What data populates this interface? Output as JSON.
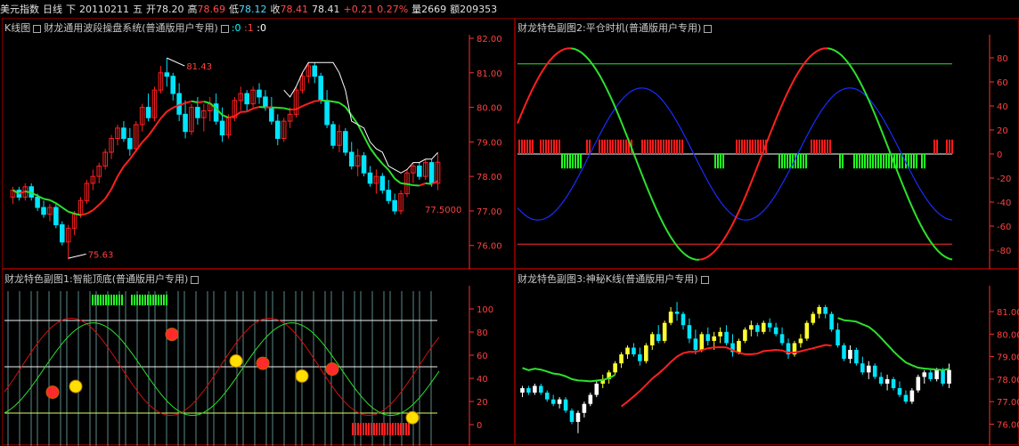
{
  "header": {
    "symbol": "美元指数",
    "period": "日线",
    "period_dir": "下",
    "date": "20110211",
    "weekday": "五",
    "open_label": "开",
    "open": "78.20",
    "high_label": "高",
    "high": "78.69",
    "low_label": "低",
    "low": "78.12",
    "close_label": "收",
    "close": "78.41",
    "last": "78.41",
    "change": "+0.21",
    "change_pct": "0.27%",
    "volume_label": "量",
    "volume": "2669",
    "amount_label": "额",
    "amount": "209353"
  },
  "main_panel": {
    "title_prefix": "K线图",
    "title": "财龙通用波段操盘系统(普通版用户专用)",
    "flags": [
      {
        "text": ":0",
        "color": "#00ffff"
      },
      {
        "text": ":1",
        "color": "#ff4040"
      },
      {
        "text": ":0",
        "color": "#ffffff"
      }
    ],
    "y_ticks": [
      "82.00",
      "81.00",
      "80.00",
      "79.00",
      "78.00",
      "77.00",
      "76.00"
    ],
    "annotations": {
      "high": "81.43",
      "low": "75.63",
      "last": "77.5000"
    }
  },
  "sub1": {
    "title": "财龙特色副图1:智能顶底(普通版用户专用)",
    "y_ticks": [
      "100",
      "80",
      "60",
      "40",
      "20",
      "0"
    ]
  },
  "sub2": {
    "title": "财龙特色副图2:平仓时机(普通版用户专用)",
    "y_ticks": [
      "80",
      "60",
      "40",
      "20",
      "0",
      "-20",
      "-40",
      "-60",
      "-80"
    ]
  },
  "sub3": {
    "title": "财龙特色副图3:神秘K线(普通版用户专用)",
    "y_ticks": [
      "81.00",
      "80.00",
      "79.00",
      "78.00",
      "77.00",
      "76.00"
    ]
  },
  "colors": {
    "up": "#ff2020",
    "down": "#00e5ff",
    "ma_red": "#ff2020",
    "ma_green": "#2de02d",
    "blue": "#1a2cff",
    "yellow": "#ffff30",
    "axis": "#ff3030",
    "frame": "#7a0000"
  },
  "chart_data": {
    "type": "candlestick",
    "series": [
      {
        "values": [
          [
            77.4,
            77.7,
            77.2,
            77.6
          ],
          [
            77.6,
            77.7,
            77.3,
            77.4
          ],
          [
            77.4,
            77.8,
            77.3,
            77.7
          ],
          [
            77.7,
            77.8,
            77.3,
            77.4
          ],
          [
            77.4,
            77.5,
            77.0,
            77.1
          ],
          [
            77.1,
            77.3,
            76.8,
            76.9
          ],
          [
            76.9,
            77.2,
            76.7,
            77.1
          ],
          [
            77.1,
            77.2,
            76.5,
            76.6
          ],
          [
            76.6,
            76.7,
            76.0,
            76.1
          ],
          [
            76.1,
            76.6,
            75.6,
            76.5
          ],
          [
            76.5,
            77.0,
            76.3,
            76.9
          ],
          [
            76.9,
            77.4,
            76.8,
            77.3
          ],
          [
            77.3,
            77.9,
            77.2,
            77.8
          ],
          [
            77.8,
            78.2,
            77.6,
            78.0
          ],
          [
            78.0,
            78.4,
            77.8,
            78.3
          ],
          [
            78.3,
            78.8,
            78.2,
            78.7
          ],
          [
            78.7,
            79.2,
            78.5,
            79.1
          ],
          [
            79.1,
            79.5,
            78.9,
            79.4
          ],
          [
            79.4,
            79.6,
            79.0,
            79.1
          ],
          [
            79.1,
            79.4,
            78.6,
            78.8
          ],
          [
            78.8,
            79.6,
            78.7,
            79.5
          ],
          [
            79.5,
            80.1,
            79.3,
            80.0
          ],
          [
            80.0,
            80.4,
            79.6,
            79.7
          ],
          [
            79.7,
            80.6,
            79.6,
            80.5
          ],
          [
            80.5,
            81.2,
            80.4,
            81.0
          ],
          [
            81.0,
            81.43,
            80.6,
            80.9
          ],
          [
            80.9,
            81.0,
            80.2,
            80.4
          ],
          [
            80.4,
            80.7,
            79.6,
            79.8
          ],
          [
            79.8,
            80.2,
            79.1,
            79.3
          ],
          [
            79.3,
            80.1,
            79.2,
            80.0
          ],
          [
            80.0,
            80.3,
            79.5,
            79.7
          ],
          [
            79.7,
            80.1,
            79.3,
            79.9
          ],
          [
            79.9,
            80.3,
            79.6,
            80.1
          ],
          [
            80.1,
            80.4,
            79.5,
            79.6
          ],
          [
            79.6,
            80.0,
            79.0,
            79.2
          ],
          [
            79.2,
            79.8,
            79.1,
            79.7
          ],
          [
            79.7,
            80.3,
            79.6,
            80.2
          ],
          [
            80.2,
            80.6,
            79.9,
            80.4
          ],
          [
            80.4,
            80.5,
            79.9,
            80.1
          ],
          [
            80.1,
            80.6,
            80.0,
            80.5
          ],
          [
            80.5,
            80.7,
            80.1,
            80.3
          ],
          [
            80.3,
            80.5,
            79.9,
            80.0
          ],
          [
            80.0,
            80.3,
            79.5,
            79.6
          ],
          [
            79.6,
            79.8,
            78.9,
            79.1
          ],
          [
            79.1,
            79.7,
            79.0,
            79.6
          ],
          [
            79.6,
            80.0,
            79.4,
            79.8
          ],
          [
            79.8,
            80.6,
            79.7,
            80.5
          ],
          [
            80.5,
            81.0,
            80.4,
            80.9
          ],
          [
            80.9,
            81.3,
            80.7,
            81.2
          ],
          [
            81.2,
            81.3,
            80.7,
            80.9
          ],
          [
            80.9,
            81.0,
            80.1,
            80.2
          ],
          [
            80.2,
            80.5,
            79.4,
            79.5
          ],
          [
            79.5,
            79.6,
            78.8,
            78.9
          ],
          [
            78.9,
            79.5,
            78.7,
            79.3
          ],
          [
            79.3,
            79.4,
            78.6,
            78.7
          ],
          [
            78.7,
            79.0,
            78.2,
            78.3
          ],
          [
            78.3,
            78.8,
            78.0,
            78.6
          ],
          [
            78.6,
            78.7,
            78.0,
            78.1
          ],
          [
            78.1,
            78.3,
            77.7,
            77.8
          ],
          [
            77.8,
            78.2,
            77.5,
            78.0
          ],
          [
            78.0,
            78.1,
            77.5,
            77.6
          ],
          [
            77.6,
            77.9,
            77.2,
            77.3
          ],
          [
            77.3,
            77.5,
            76.9,
            77.0
          ],
          [
            77.0,
            77.6,
            76.9,
            77.5
          ],
          [
            77.5,
            78.2,
            77.4,
            78.1
          ],
          [
            78.1,
            78.4,
            77.8,
            78.3
          ],
          [
            78.3,
            78.4,
            77.9,
            78.0
          ],
          [
            78.0,
            78.5,
            77.9,
            78.4
          ],
          [
            78.4,
            78.5,
            77.7,
            77.8
          ],
          [
            77.8,
            78.69,
            77.6,
            78.41
          ]
        ]
      }
    ]
  }
}
